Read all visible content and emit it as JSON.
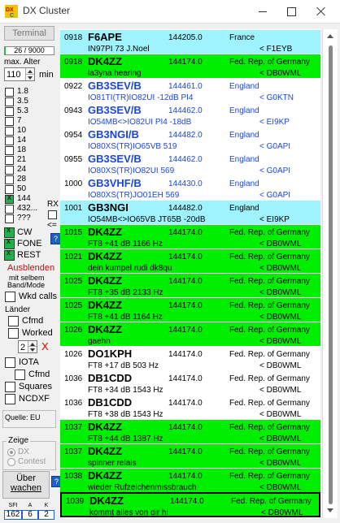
{
  "window": {
    "title": "DX Cluster"
  },
  "left": {
    "terminal_button": "Terminal",
    "progress_text": "26 / 9000",
    "progress_fraction": 0.003,
    "max_age_label": "max. Alter",
    "max_age_value": "110",
    "max_age_unit": "min",
    "bands": [
      {
        "label": "1.8",
        "checked": false
      },
      {
        "label": "3.5",
        "checked": false
      },
      {
        "label": "5.3",
        "checked": false
      },
      {
        "label": "7",
        "checked": false
      },
      {
        "label": "10",
        "checked": false
      },
      {
        "label": "14",
        "checked": false
      },
      {
        "label": "18",
        "checked": false
      },
      {
        "label": "21",
        "checked": false
      },
      {
        "label": "24",
        "checked": false
      },
      {
        "label": "28",
        "checked": false
      },
      {
        "label": "50",
        "checked": false
      },
      {
        "label": "144",
        "checked": true
      },
      {
        "label": "432...",
        "checked": false
      },
      {
        "label": "???",
        "checked": false
      }
    ],
    "rx_label": "RX",
    "rx_arrow": "<=",
    "modes": [
      {
        "label": "CW",
        "checked": true
      },
      {
        "label": "FONE",
        "checked": true
      },
      {
        "label": "REST",
        "checked": true
      }
    ],
    "help_label": "?",
    "ausblenden": "Ausblenden",
    "mit_selbem": "mit selbem",
    "band_mode": "Band/Mode",
    "wkd_calls": "Wkd calls",
    "laender": "Länder",
    "cfmd": "Cfmd",
    "worked": "Worked",
    "worked_spin_value": "2",
    "worked_x": "X",
    "iota": "IOTA",
    "iota_cfmd": "Cfmd",
    "squares": "Squares",
    "ncdxf": "NCDXF",
    "source_label": "Quelle: EU",
    "zeige": "Zeige",
    "zeige_dx": "DX",
    "zeige_contest": "Contest",
    "ueberwachen_line1": "Über",
    "ueberwachen_line2": "wachen",
    "stats": [
      {
        "label": "SFI",
        "value": "162"
      },
      {
        "label": "A",
        "value": "6"
      },
      {
        "label": "K",
        "value": "2"
      }
    ]
  },
  "colors": {
    "green": "#00ee00",
    "cyan": "#9ff3ff",
    "white": "#ffffff",
    "blue_text": "#1a46e0"
  },
  "spots": [
    {
      "time": "0918",
      "call": "F6APE",
      "freq": "144205.0",
      "country": "France",
      "comment": "IN97PI 73 J.Noel",
      "spotter": "< F1EYB",
      "bg": "cyan",
      "blue": false
    },
    {
      "time": "0918",
      "call": "DK4ZZ",
      "freq": "144174.0",
      "country": "Fed. Rep. of Germany",
      "comment": "la3yna hearing",
      "spotter": "< DB0WML",
      "bg": "green",
      "blue": false
    },
    {
      "time": "0922",
      "call": "GB3SEV/B",
      "freq": "144461.0",
      "country": "England",
      "comment": "IO81TI(TR)IO82UI -12dB PI4",
      "spotter": "< G0KTN",
      "bg": "white",
      "blue": true
    },
    {
      "time": "0943",
      "call": "GB3SEV/B",
      "freq": "144462.0",
      "country": "England",
      "comment": "IO54MB<>IO82UI PI4 -18dB",
      "spotter": "< EI9KP",
      "bg": "white",
      "blue": true
    },
    {
      "time": "0954",
      "call": "GB3NGI/B",
      "freq": "144482.0",
      "country": "England",
      "comment": "IO80XS(TR)IO65VB 519",
      "spotter": "< G0API",
      "bg": "white",
      "blue": true
    },
    {
      "time": "0955",
      "call": "GB3SEV/B",
      "freq": "144462.0",
      "country": "England",
      "comment": "IO80XS(TR)IO82UI 569",
      "spotter": "< G0API",
      "bg": "white",
      "blue": true
    },
    {
      "time": "1000",
      "call": "GB3VHF/B",
      "freq": "144430.0",
      "country": "England",
      "comment": "IO80XS(TR)JO01EH 569",
      "spotter": "< G0API",
      "bg": "white",
      "blue": true
    },
    {
      "time": "1001",
      "call": "GB3NGI",
      "freq": "144482.0",
      "country": "England",
      "comment": "IO54MB<>IO65VB JT65B -20dB",
      "spotter": "< EI9KP",
      "bg": "cyan",
      "blue": false
    },
    {
      "time": "1015",
      "call": "DK4ZZ",
      "freq": "144174.0",
      "country": "Fed. Rep. of Germany",
      "comment": "FT8 +41 dB 1166 Hz",
      "spotter": "< DB0WML",
      "bg": "green",
      "blue": false
    },
    {
      "time": "1021",
      "call": "DK4ZZ",
      "freq": "144174.0",
      "country": "Fed. Rep. of Germany",
      "comment": "dein kumpel rudi dk8qu",
      "spotter": "< DB0WML",
      "bg": "green",
      "blue": false
    },
    {
      "time": "1025",
      "call": "DK4ZZ",
      "freq": "144174.0",
      "country": "Fed. Rep. of Germany",
      "comment": "FT8 +35 dB 2133 Hz",
      "spotter": "< DB0WML",
      "bg": "green",
      "blue": false
    },
    {
      "time": "1025",
      "call": "DK4ZZ",
      "freq": "144174.0",
      "country": "Fed. Rep. of Germany",
      "comment": "FT8 +41 dB 1164 Hz",
      "spotter": "< DB0WML",
      "bg": "green",
      "blue": false
    },
    {
      "time": "1026",
      "call": "DK4ZZ",
      "freq": "144174.0",
      "country": "Fed. Rep. of Germany",
      "comment": "gaehn",
      "spotter": "< DB0WML",
      "bg": "green",
      "blue": false
    },
    {
      "time": "1026",
      "call": "DO1KPH",
      "freq": "144174.0",
      "country": "Fed. Rep. of Germany",
      "comment": "FT8 +17 dB 503 Hz",
      "spotter": "< DB0WML",
      "bg": "white",
      "blue": false
    },
    {
      "time": "1036",
      "call": "DB1CDD",
      "freq": "144174.0",
      "country": "Fed. Rep. of Germany",
      "comment": "FT8 +34 dB 1543 Hz",
      "spotter": "< DB0WML",
      "bg": "white",
      "blue": false
    },
    {
      "time": "1036",
      "call": "DB1CDD",
      "freq": "144174.0",
      "country": "Fed. Rep. of Germany",
      "comment": "FT8 +38 dB 1543 Hz",
      "spotter": "< DB0WML",
      "bg": "white",
      "blue": false
    },
    {
      "time": "1037",
      "call": "DK4ZZ",
      "freq": "144174.0",
      "country": "Fed. Rep. of Germany",
      "comment": "FT8 +44 dB 1387 Hz",
      "spotter": "< DB0WML",
      "bg": "green",
      "blue": false
    },
    {
      "time": "1037",
      "call": "DK4ZZ",
      "freq": "144174.0",
      "country": "Fed. Rep. of Germany",
      "comment": "spinner relais",
      "spotter": "< DB0WML",
      "bg": "green",
      "blue": false
    },
    {
      "time": "1038",
      "call": "DK4ZZ",
      "freq": "144174.0",
      "country": "Fed. Rep. of Germany",
      "comment": "wieder Rufzeichenmissbrauch",
      "spotter": "< DB0WML",
      "bg": "green",
      "blue": false
    },
    {
      "time": "1039",
      "call": "DK4ZZ",
      "freq": "144174.0",
      "country": "Fed. Rep. of Germany",
      "comment": "kommt alles von dir hi",
      "spotter": "< DB0WML",
      "bg": "green",
      "blue": false,
      "selected": true
    }
  ]
}
